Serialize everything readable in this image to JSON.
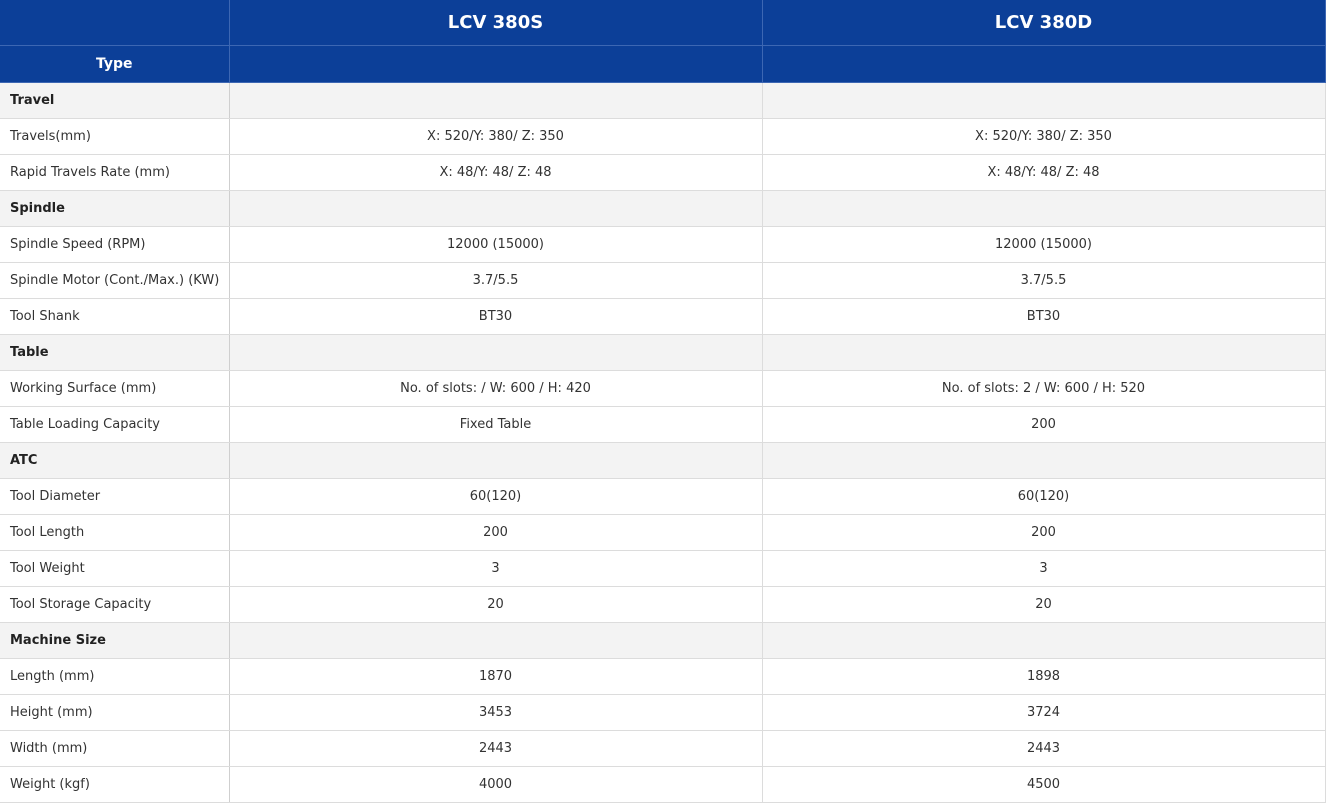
{
  "header": {
    "corner": "",
    "models": [
      "LCV 380S",
      "LCV 380D"
    ],
    "type_label": "Type"
  },
  "rows": [
    {
      "kind": "section",
      "label": "Travel"
    },
    {
      "kind": "data",
      "label": "Travels(mm)",
      "a": "X: 520/Y: 380/ Z: 350",
      "b": "X: 520/Y: 380/ Z: 350"
    },
    {
      "kind": "data",
      "label": "Rapid Travels Rate (mm)",
      "a": "X: 48/Y: 48/ Z: 48",
      "b": "X: 48/Y: 48/ Z: 48"
    },
    {
      "kind": "section",
      "label": "Spindle"
    },
    {
      "kind": "data",
      "label": "Spindle Speed (RPM)",
      "a": "12000 (15000)",
      "b": "12000 (15000)"
    },
    {
      "kind": "data",
      "label": "Spindle Motor (Cont./Max.) (KW)",
      "a": "3.7/5.5",
      "b": "3.7/5.5"
    },
    {
      "kind": "data",
      "label": "Tool Shank",
      "a": "BT30",
      "b": "BT30"
    },
    {
      "kind": "section",
      "label": "Table"
    },
    {
      "kind": "data",
      "label": "Working Surface (mm)",
      "a": "No. of slots: / W: 600 / H: 420",
      "b": "No. of slots: 2 / W: 600 / H: 520"
    },
    {
      "kind": "data",
      "label": "Table Loading Capacity",
      "a": "Fixed Table",
      "b": "200"
    },
    {
      "kind": "section",
      "label": "ATC"
    },
    {
      "kind": "data",
      "label": "Tool Diameter",
      "a": "60(120)",
      "b": "60(120)"
    },
    {
      "kind": "data",
      "label": "Tool Length",
      "a": "200",
      "b": "200"
    },
    {
      "kind": "data",
      "label": "Tool Weight",
      "a": "3",
      "b": "3"
    },
    {
      "kind": "data",
      "label": "Tool Storage Capacity",
      "a": "20",
      "b": "20"
    },
    {
      "kind": "section",
      "label": "Machine Size"
    },
    {
      "kind": "data",
      "label": "Length (mm)",
      "a": "1870",
      "b": "1898"
    },
    {
      "kind": "data",
      "label": "Height (mm)",
      "a": "3453",
      "b": "3724"
    },
    {
      "kind": "data",
      "label": "Width (mm)",
      "a": "2443",
      "b": "2443"
    },
    {
      "kind": "data",
      "label": "Weight (kgf)",
      "a": "4000",
      "b": "4500"
    }
  ]
}
